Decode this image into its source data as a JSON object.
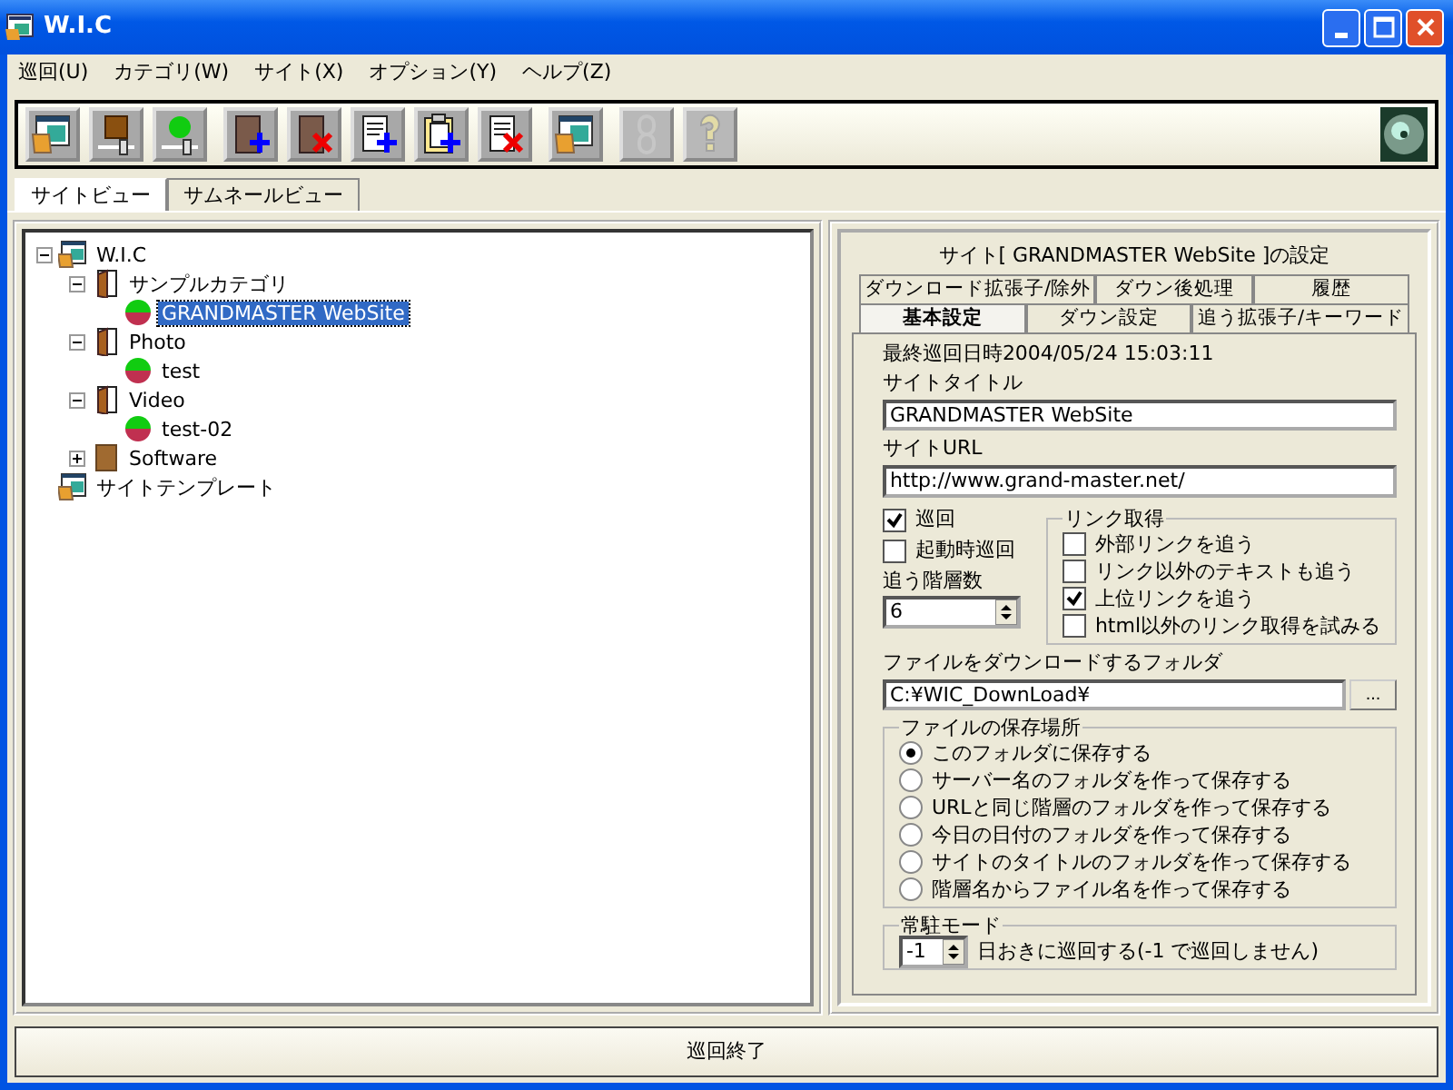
{
  "window": {
    "title": "W.I.C"
  },
  "menu": [
    "巡回(U)",
    "カテゴリ(W)",
    "サイト(X)",
    "オプション(Y)",
    "ヘルプ(Z)"
  ],
  "toolbar": [
    {
      "kind": "window-folder",
      "disabled": false
    },
    {
      "kind": "box-slider",
      "disabled": false
    },
    {
      "kind": "ball-slider",
      "disabled": false
    },
    {
      "kind": "book-add",
      "disabled": false
    },
    {
      "kind": "book-delete",
      "disabled": false
    },
    {
      "kind": "page-add",
      "disabled": false
    },
    {
      "kind": "clipboard-add",
      "disabled": false
    },
    {
      "kind": "page-delete",
      "disabled": false
    },
    {
      "kind": "window-folder",
      "disabled": false
    },
    {
      "kind": "chain",
      "disabled": true
    },
    {
      "kind": "help",
      "disabled": true
    }
  ],
  "view_tabs": [
    {
      "label": "サイトビュー",
      "selected": true
    },
    {
      "label": "サムネールビュー",
      "selected": false
    }
  ],
  "tree": [
    {
      "label": "W.I.C",
      "kind": "root",
      "expanded": true,
      "selected": false,
      "children": [
        {
          "label": "サンプルカテゴリ",
          "kind": "category",
          "expanded": true,
          "selected": false,
          "children": [
            {
              "label": "GRANDMASTER WebSite",
              "kind": "site",
              "selected": true
            }
          ]
        },
        {
          "label": "Photo",
          "kind": "category",
          "expanded": true,
          "selected": false,
          "children": [
            {
              "label": "test",
              "kind": "site",
              "selected": false
            }
          ]
        },
        {
          "label": "Video",
          "kind": "category",
          "expanded": true,
          "selected": false,
          "children": [
            {
              "label": "test-02",
              "kind": "site",
              "selected": false
            }
          ]
        },
        {
          "label": "Software",
          "kind": "closed-category",
          "expanded": false,
          "selected": false
        }
      ]
    },
    {
      "label": "サイトテンプレート",
      "kind": "root",
      "selected": false
    }
  ],
  "settings": {
    "title": "サイト[ GRANDMASTER WebSite ]の設定",
    "tab_rows": [
      [
        {
          "label": "ダウンロード拡張子/除外",
          "selected": false
        },
        {
          "label": "ダウン後処理",
          "selected": false
        },
        {
          "label": "履歴",
          "selected": false
        }
      ],
      [
        {
          "label": "基本設定",
          "selected": true
        },
        {
          "label": "ダウン設定",
          "selected": false
        },
        {
          "label": "追う拡張子/キーワード",
          "selected": false
        }
      ]
    ],
    "last_patrol": "最終巡回日時2004/05/24 15:03:11",
    "site_title": {
      "label": "サイトタイトル",
      "value": "GRANDMASTER WebSite"
    },
    "site_url": {
      "label": "サイトURL",
      "value": "http://www.grand-master.net/"
    },
    "checkboxes": [
      {
        "label": "巡回",
        "checked": true
      },
      {
        "label": "起動時巡回",
        "checked": false
      }
    ],
    "depth": {
      "label": "追う階層数",
      "value": "6"
    },
    "link_group": {
      "title": "リンク取得",
      "options": [
        {
          "label": "外部リンクを追う",
          "checked": false
        },
        {
          "label": "リンク以外のテキストも追う",
          "checked": false
        },
        {
          "label": "上位リンクを追う",
          "checked": true
        },
        {
          "label": "html以外のリンク取得を試みる",
          "checked": false
        }
      ]
    },
    "folder": {
      "label": "ファイルをダウンロードするフォルダ",
      "value": "C:¥WIC_DownLoad¥",
      "browse": "..."
    },
    "save_group": {
      "title": "ファイルの保存場所",
      "options": [
        {
          "label": "このフォルダに保存する",
          "selected": true
        },
        {
          "label": "サーバー名のフォルダを作って保存する",
          "selected": false
        },
        {
          "label": "URLと同じ階層のフォルダを作って保存する",
          "selected": false
        },
        {
          "label": "今日の日付のフォルダを作って保存する",
          "selected": false
        },
        {
          "label": "サイトのタイトルのフォルダを作って保存する",
          "selected": false
        },
        {
          "label": "階層名からファイル名を作って保存する",
          "selected": false
        }
      ]
    },
    "resident": {
      "title": "常駐モード",
      "value": "-1",
      "text": "日おきに巡回する(-1 で巡回しません)"
    }
  },
  "status_bar": "巡回終了"
}
